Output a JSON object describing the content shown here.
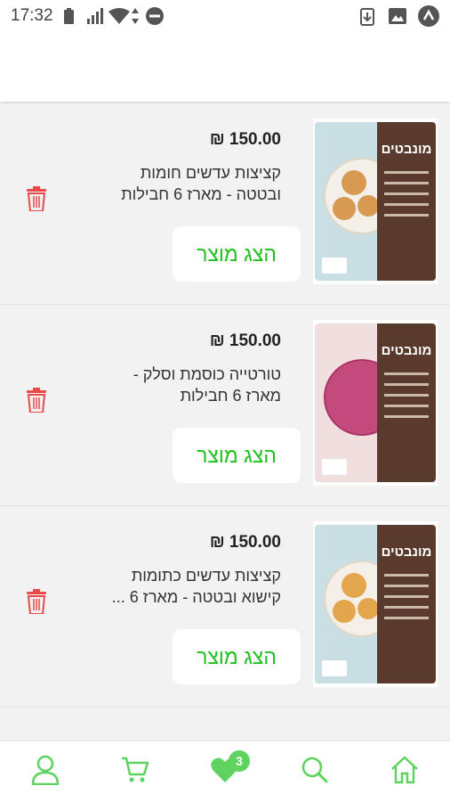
{
  "status_bar": {
    "time": "17:32",
    "icons": [
      "battery-icon",
      "signal-icon",
      "wifi-icon",
      "data-arrows-icon",
      "do-not-disturb-icon",
      "download-icon",
      "image-icon",
      "app-logo-icon"
    ]
  },
  "products": [
    {
      "price": "₪ 150.00",
      "name": "קציצות עדשים חומות ובטטה - מארז 6 חבילות",
      "button_label": "הצג מוצר",
      "package_brand": "מונבטים",
      "image_style": "brown"
    },
    {
      "price": "₪ 150.00",
      "name": "טורטייה כוסמת וסלק - מארז 6 חבילות",
      "button_label": "הצג מוצר",
      "package_brand": "מונבטים",
      "image_style": "pink"
    },
    {
      "price": "₪ 150.00",
      "name": "קציצות עדשים כתומות קישוא ובטטה - מארז 6 ...",
      "button_label": "הצג מוצר",
      "package_brand": "מונבטים",
      "image_style": "brown"
    }
  ],
  "bottom_nav": {
    "items": [
      "profile-icon",
      "cart-icon",
      "favorites-icon",
      "search-icon",
      "home-icon"
    ],
    "favorites_count": "3"
  },
  "colors": {
    "accent_green": "#1cc21c",
    "trash_red": "#e84a4a",
    "nav_icon_green": "#5fd35f",
    "background": "#f2f2f2"
  }
}
